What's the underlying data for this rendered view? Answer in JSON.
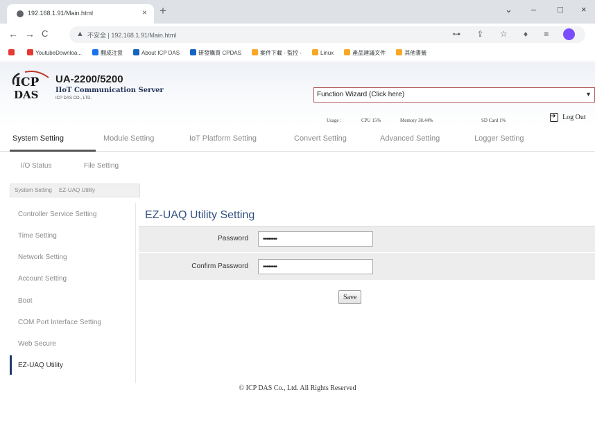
{
  "browser": {
    "tab_title": "192.168.1.91/Main.html",
    "tab_close": "×",
    "new_tab": "+",
    "window_controls": [
      "⌄",
      "–",
      "□",
      "×"
    ],
    "nav": [
      "←",
      "→",
      "C"
    ],
    "security_label": "不安全",
    "url": "192.168.1.91/Main.html",
    "omnibox_icons": "⊶ ⇪ ☆",
    "toolbar_icons": "♦ ≡ □",
    "bookmarks": [
      {
        "label": "",
        "color": "#e53935"
      },
      {
        "label": "YoutubeDownloa...",
        "color": "#e53935"
      },
      {
        "label": "翻成注意",
        "color": "#1a73e8"
      },
      {
        "label": "About ICP DAS",
        "color": "#1565c0"
      },
      {
        "label": "研發購買 CPDAS",
        "color": "#1565c0"
      },
      {
        "label": "案件下載 - 監控 -",
        "color": "#f9a825"
      },
      {
        "label": "Linux",
        "color": "#f9a825"
      },
      {
        "label": "產品建議文件",
        "color": "#f9a825"
      },
      {
        "label": "其他書籤",
        "color": "#f9a825"
      }
    ]
  },
  "header": {
    "logo_top": "ICP",
    "logo_bottom": "DAS",
    "model": "UA-2200/5200",
    "subtitle": "IIoT Communication Server",
    "company": "ICP DAS CO., LTD.",
    "wizard_value": "Function Wizard  (Click here)",
    "wizard_arrow": "▼",
    "usage": {
      "label": "Usage :",
      "cpu": "CPU  15%",
      "memory": "Memory  38.44%",
      "sdcard": "SD Card   1%"
    },
    "logout_label": "Log Out"
  },
  "main_tabs": [
    "System Setting",
    "Module Setting",
    "IoT Platform Setting",
    "Convert Setting",
    "Advanced Setting",
    "Logger Setting"
  ],
  "sub_tabs": [
    "I/O Status",
    "File Setting"
  ],
  "breadcrumb": [
    "System Setting",
    "EZ-UAQ Utility"
  ],
  "sidebar": {
    "items": [
      "Controller Service Setting",
      "Time Setting",
      "Network Setting",
      "Account Setting",
      "Boot",
      "COM Port Interface Setting",
      "Web Secure",
      "EZ-UAQ Utility"
    ]
  },
  "form": {
    "title": "EZ-UAQ Utility Setting",
    "password_label": "Password",
    "password_value": "••••••••",
    "confirm_label": "Confirm Password",
    "confirm_value": "••••••••",
    "save_label": "Save"
  },
  "footer": "© ICP DAS Co., Ltd. All Rights Reserved"
}
